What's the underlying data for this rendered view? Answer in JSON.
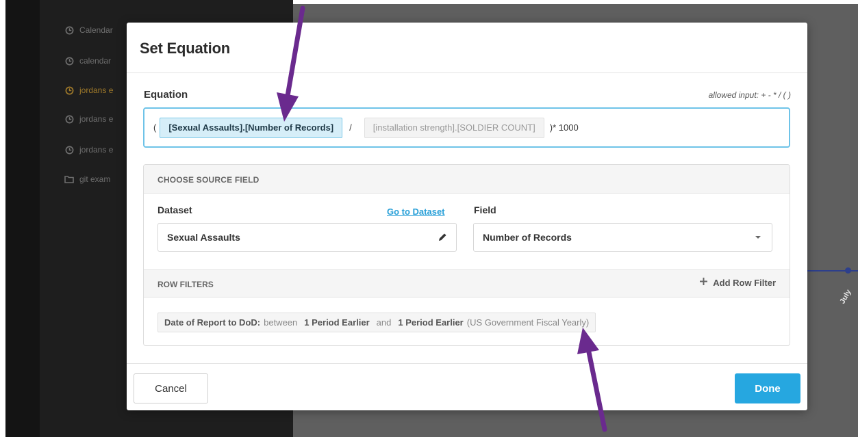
{
  "sidebar": {
    "items": [
      {
        "label": "Calendar",
        "icon": "clock-icon",
        "active": false
      },
      {
        "label": "calendar",
        "icon": "clock-icon",
        "active": false
      },
      {
        "label": "jordans e",
        "icon": "clock-icon",
        "active": true
      },
      {
        "label": "jordans e",
        "icon": "clock-icon",
        "active": false
      },
      {
        "label": "jordans e",
        "icon": "clock-icon",
        "active": false
      },
      {
        "label": "git exam",
        "icon": "folder-icon",
        "active": false
      }
    ]
  },
  "background_chart": {
    "x_tick_label": "July",
    "line_color": "#2d3f8c"
  },
  "modal": {
    "title": "Set Equation",
    "equation": {
      "label": "Equation",
      "hint": "allowed input: + - * / ( )",
      "open_paren": "(",
      "token_1": "[Sexual Assaults].[Number of Records]",
      "operator": "/",
      "token_2": "[installation strength].[SOLDIER COUNT]",
      "suffix": ")* 1000"
    },
    "source_field": {
      "header": "CHOOSE SOURCE FIELD",
      "dataset_label": "Dataset",
      "goto_link": "Go to Dataset",
      "dataset_value": "Sexual Assaults",
      "field_label": "Field",
      "field_value": "Number of Records"
    },
    "row_filters": {
      "header": "ROW FILTERS",
      "add_label": "Add Row Filter",
      "filter": {
        "field": "Date of Report to DoD:",
        "word_between": "between",
        "from": "1 Period Earlier",
        "word_and": "and",
        "to": "1 Period Earlier",
        "calendar": "(US Government Fiscal Yearly)"
      }
    },
    "footer": {
      "cancel_label": "Cancel",
      "done_label": "Done"
    }
  },
  "colors": {
    "accent": "#26a7e0",
    "token_bg": "#d6eef8",
    "annotation_arrow": "#6a2a8e"
  }
}
